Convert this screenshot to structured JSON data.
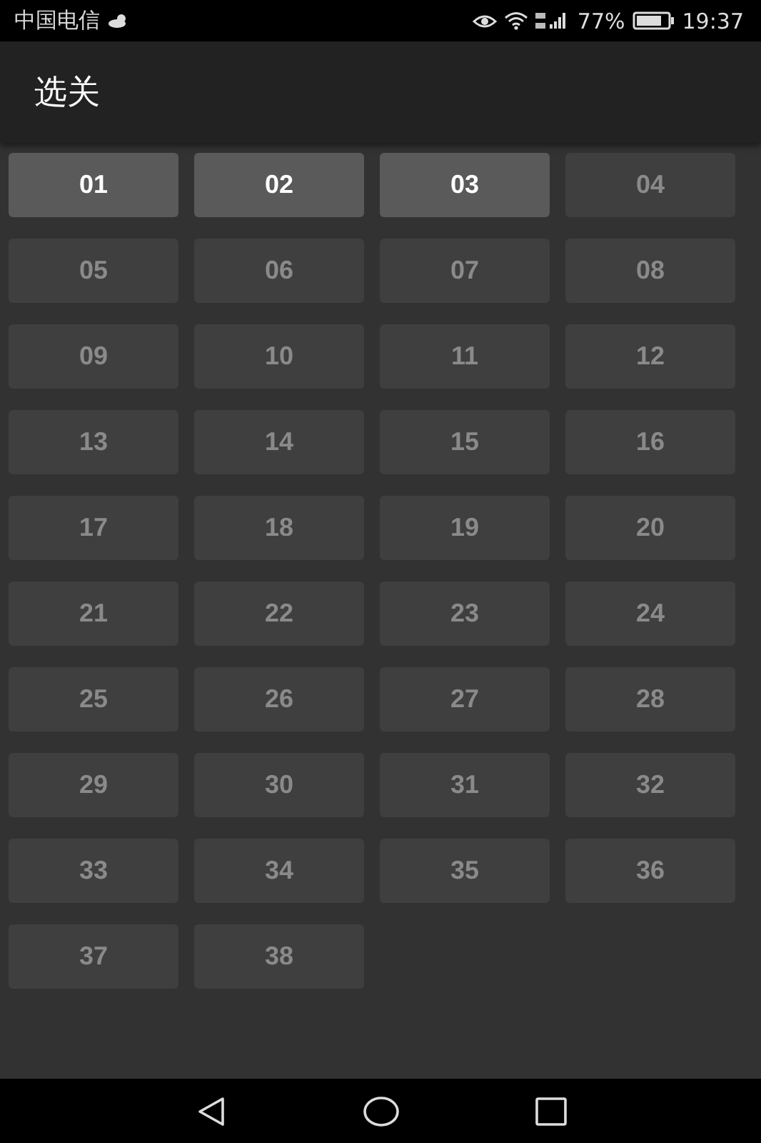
{
  "status_bar": {
    "carrier": "中国电信",
    "battery": "77%",
    "time": "19:37"
  },
  "app_bar": {
    "title": "选关"
  },
  "levels": [
    {
      "label": "01",
      "unlocked": true
    },
    {
      "label": "02",
      "unlocked": true
    },
    {
      "label": "03",
      "unlocked": true
    },
    {
      "label": "04",
      "unlocked": false
    },
    {
      "label": "05",
      "unlocked": false
    },
    {
      "label": "06",
      "unlocked": false
    },
    {
      "label": "07",
      "unlocked": false
    },
    {
      "label": "08",
      "unlocked": false
    },
    {
      "label": "09",
      "unlocked": false
    },
    {
      "label": "10",
      "unlocked": false
    },
    {
      "label": "11",
      "unlocked": false
    },
    {
      "label": "12",
      "unlocked": false
    },
    {
      "label": "13",
      "unlocked": false
    },
    {
      "label": "14",
      "unlocked": false
    },
    {
      "label": "15",
      "unlocked": false
    },
    {
      "label": "16",
      "unlocked": false
    },
    {
      "label": "17",
      "unlocked": false
    },
    {
      "label": "18",
      "unlocked": false
    },
    {
      "label": "19",
      "unlocked": false
    },
    {
      "label": "20",
      "unlocked": false
    },
    {
      "label": "21",
      "unlocked": false
    },
    {
      "label": "22",
      "unlocked": false
    },
    {
      "label": "23",
      "unlocked": false
    },
    {
      "label": "24",
      "unlocked": false
    },
    {
      "label": "25",
      "unlocked": false
    },
    {
      "label": "26",
      "unlocked": false
    },
    {
      "label": "27",
      "unlocked": false
    },
    {
      "label": "28",
      "unlocked": false
    },
    {
      "label": "29",
      "unlocked": false
    },
    {
      "label": "30",
      "unlocked": false
    },
    {
      "label": "31",
      "unlocked": false
    },
    {
      "label": "32",
      "unlocked": false
    },
    {
      "label": "33",
      "unlocked": false
    },
    {
      "label": "34",
      "unlocked": false
    },
    {
      "label": "35",
      "unlocked": false
    },
    {
      "label": "36",
      "unlocked": false
    },
    {
      "label": "37",
      "unlocked": false
    },
    {
      "label": "38",
      "unlocked": false
    }
  ]
}
